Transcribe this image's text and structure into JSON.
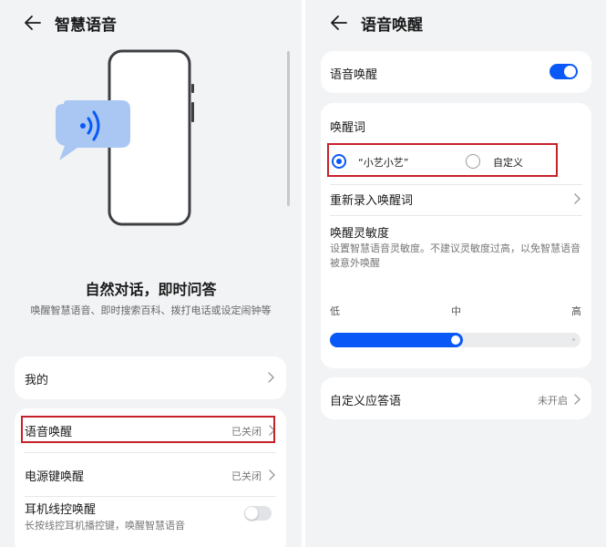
{
  "left": {
    "title": "智慧语音",
    "headline": "自然对话，即时问答",
    "description": "唤醒智慧语音、即时搜索百科、拨打电话或设定闹钟等",
    "items": {
      "mine": {
        "label": "我的"
      },
      "voice_wake": {
        "label": "语音唤醒",
        "value": "已关闭"
      },
      "power_key_wake": {
        "label": "电源键唤醒",
        "value": "已关闭"
      },
      "earphone_wake": {
        "label": "耳机线控唤醒",
        "sublabel": "长按线控耳机播控键，唤醒智慧语音",
        "toggle": "off"
      }
    }
  },
  "right": {
    "title": "语音唤醒",
    "voice_wake_label": "语音唤醒",
    "voice_wake_toggle": "on",
    "wake_word_header": "唤醒词",
    "wake_word_options": [
      {
        "label": "“小艺小艺”",
        "selected": true
      },
      {
        "label": "自定义",
        "selected": false
      }
    ],
    "rerecord_label": "重新录入唤醒词",
    "sensitivity": {
      "title": "唤醒灵敏度",
      "description": "设置智慧语音灵敏度。不建议灵敏度过高，以免智慧语音被意外唤醒",
      "levels": [
        "低",
        "中",
        "高"
      ],
      "selected": "中",
      "level_fraction": 0.5
    },
    "custom_reply": {
      "label": "自定义应答语",
      "value": "未开启"
    }
  },
  "colors": {
    "accent": "#0a59f7",
    "highlight": "#c8202a",
    "background": "#f1f3f5"
  },
  "icons": [
    "back-arrow-icon",
    "chevron-right-icon",
    "sound-wave-icon"
  ]
}
